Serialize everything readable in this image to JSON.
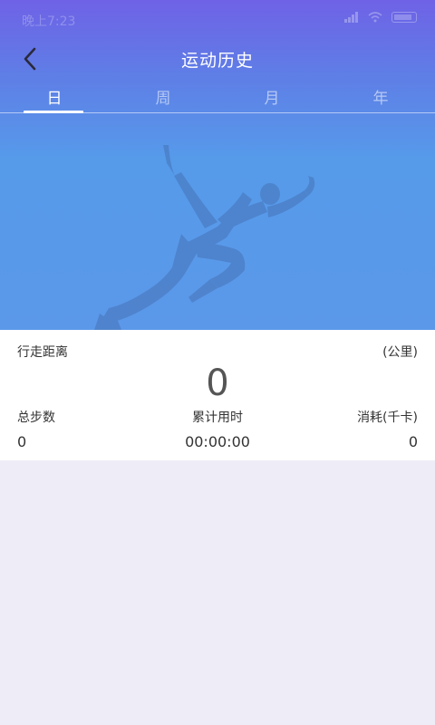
{
  "status_bar": {
    "time": "晚上7:23",
    "network": "ᵢₗ"
  },
  "header": {
    "title": "运动历史",
    "back_icon": "chevron-left-icon"
  },
  "tabs": [
    {
      "label": "日",
      "active": true
    },
    {
      "label": "周",
      "active": false
    },
    {
      "label": "月",
      "active": false
    },
    {
      "label": "年",
      "active": false
    }
  ],
  "summary": {
    "distance_label": "行走距离",
    "distance_unit": "(公里)",
    "distance_value": "0",
    "steps_label": "总步数",
    "steps_value": "0",
    "duration_label": "累计用时",
    "duration_value": "00:00:00",
    "calories_label": "消耗(千卡)",
    "calories_value": "0"
  },
  "colors": {
    "gradient_top": "#6f62e6",
    "gradient_bottom": "#5b98e9",
    "background": "#eeedf7"
  }
}
